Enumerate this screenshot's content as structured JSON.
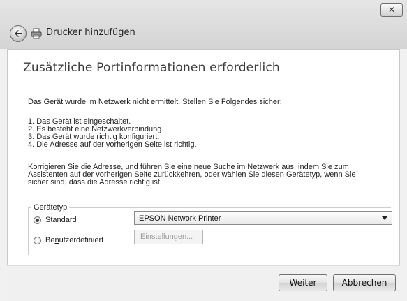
{
  "window": {
    "title": "Drucker hinzufügen",
    "close_label": "✕"
  },
  "main": {
    "heading": "Zusätzliche Portinformationen erforderlich",
    "intro": "Das Gerät wurde im Netzwerk nicht ermittelt. Stellen Sie Folgendes sicher:",
    "steps": [
      "1. Das Gerät ist eingeschaltet.",
      "2. Es besteht eine Netzwerkverbindung.",
      "3. Das Gerät wurde richtig konfiguriert.",
      "4. Die Adresse auf der vorherigen Seite ist richtig."
    ],
    "note_lines": [
      "Korrigieren Sie die Adresse, und führen Sie eine neue Suche im Netzwerk aus, indem Sie zum",
      "Assistenten auf der vorherigen Seite zurückkehren, oder wählen Sie diesen Gerätetyp, wenn Sie",
      "sicher sind, dass die Adresse richtig ist."
    ]
  },
  "device_type": {
    "legend": "Gerätetyp",
    "standard_label_mnemonic": "S",
    "standard_label_rest": "tandard",
    "standard_selected": true,
    "standard_value": "EPSON Network Printer",
    "custom_label_pre": "Be",
    "custom_label_mnemonic": "n",
    "custom_label_rest": "utzerdefiniert",
    "settings_mnemonic": "E",
    "settings_rest": "instellungen..."
  },
  "footer": {
    "next_label": "Weiter",
    "cancel_label": "Abbrechen"
  },
  "icons": {
    "back": "back-arrow-icon",
    "printer": "printer-icon",
    "close": "close-icon"
  }
}
